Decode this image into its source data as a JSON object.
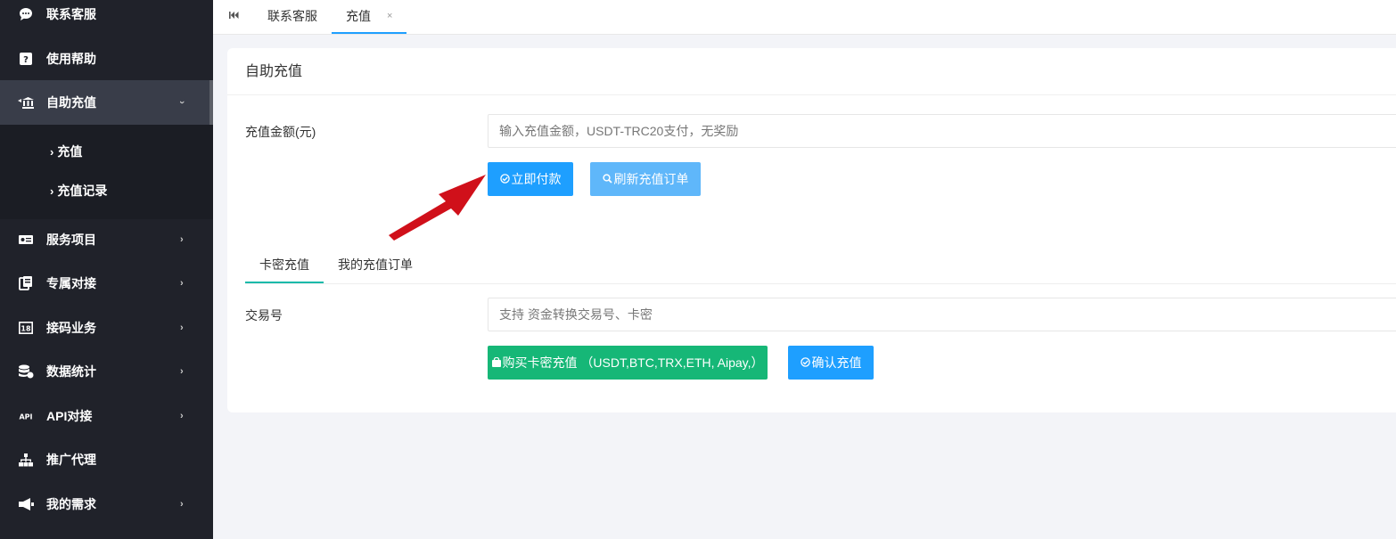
{
  "sidebar": {
    "items": [
      {
        "label": "联系客服",
        "icon": "chat-bubble-icon",
        "has_arrow": false
      },
      {
        "label": "使用帮助",
        "icon": "question-icon",
        "has_arrow": false
      },
      {
        "label": "自助充值",
        "icon": "bank-icon",
        "has_arrow": true,
        "expanded": true
      },
      {
        "label": "服务项目",
        "icon": "id-card-icon",
        "has_arrow": true
      },
      {
        "label": "专属对接",
        "icon": "device-icon",
        "has_arrow": true
      },
      {
        "label": "接码业务",
        "icon": "code-icon",
        "has_arrow": true
      },
      {
        "label": "数据统计",
        "icon": "database-icon",
        "has_arrow": true
      },
      {
        "label": "API对接",
        "icon": "api-icon",
        "has_arrow": true
      },
      {
        "label": "推广代理",
        "icon": "sitemap-icon",
        "has_arrow": false
      },
      {
        "label": "我的需求",
        "icon": "megaphone-icon",
        "has_arrow": true
      }
    ],
    "subitems": [
      {
        "label": "充值"
      },
      {
        "label": "充值记录"
      }
    ]
  },
  "tabs": {
    "home_icon": "rewind-icon",
    "items": [
      {
        "label": "联系客服"
      },
      {
        "label": "充值",
        "active": true,
        "close": "×"
      }
    ]
  },
  "card": {
    "title": "自助充值",
    "amount_label": "充值金额(元)",
    "amount_placeholder": "输入充值金额，USDT-TRC20支付，无奖励",
    "pay_now": "立即付款",
    "refresh_orders": "刷新充值订单",
    "inner_tabs": [
      {
        "label": "卡密充值",
        "active": true
      },
      {
        "label": "我的充值订单"
      }
    ],
    "txn_label": "交易号",
    "txn_placeholder": "支持 资金转换交易号、卡密",
    "buy_card": "购买卡密充值 （USDT,BTC,TRX,ETH, Aipay,）",
    "confirm": "确认充值"
  },
  "colors": {
    "sidebar_bg": "#20222a",
    "primary": "#1e9fff",
    "light_blue": "#5fb7fa",
    "green": "#16b777",
    "annotation_arrow": "#d0101a"
  }
}
